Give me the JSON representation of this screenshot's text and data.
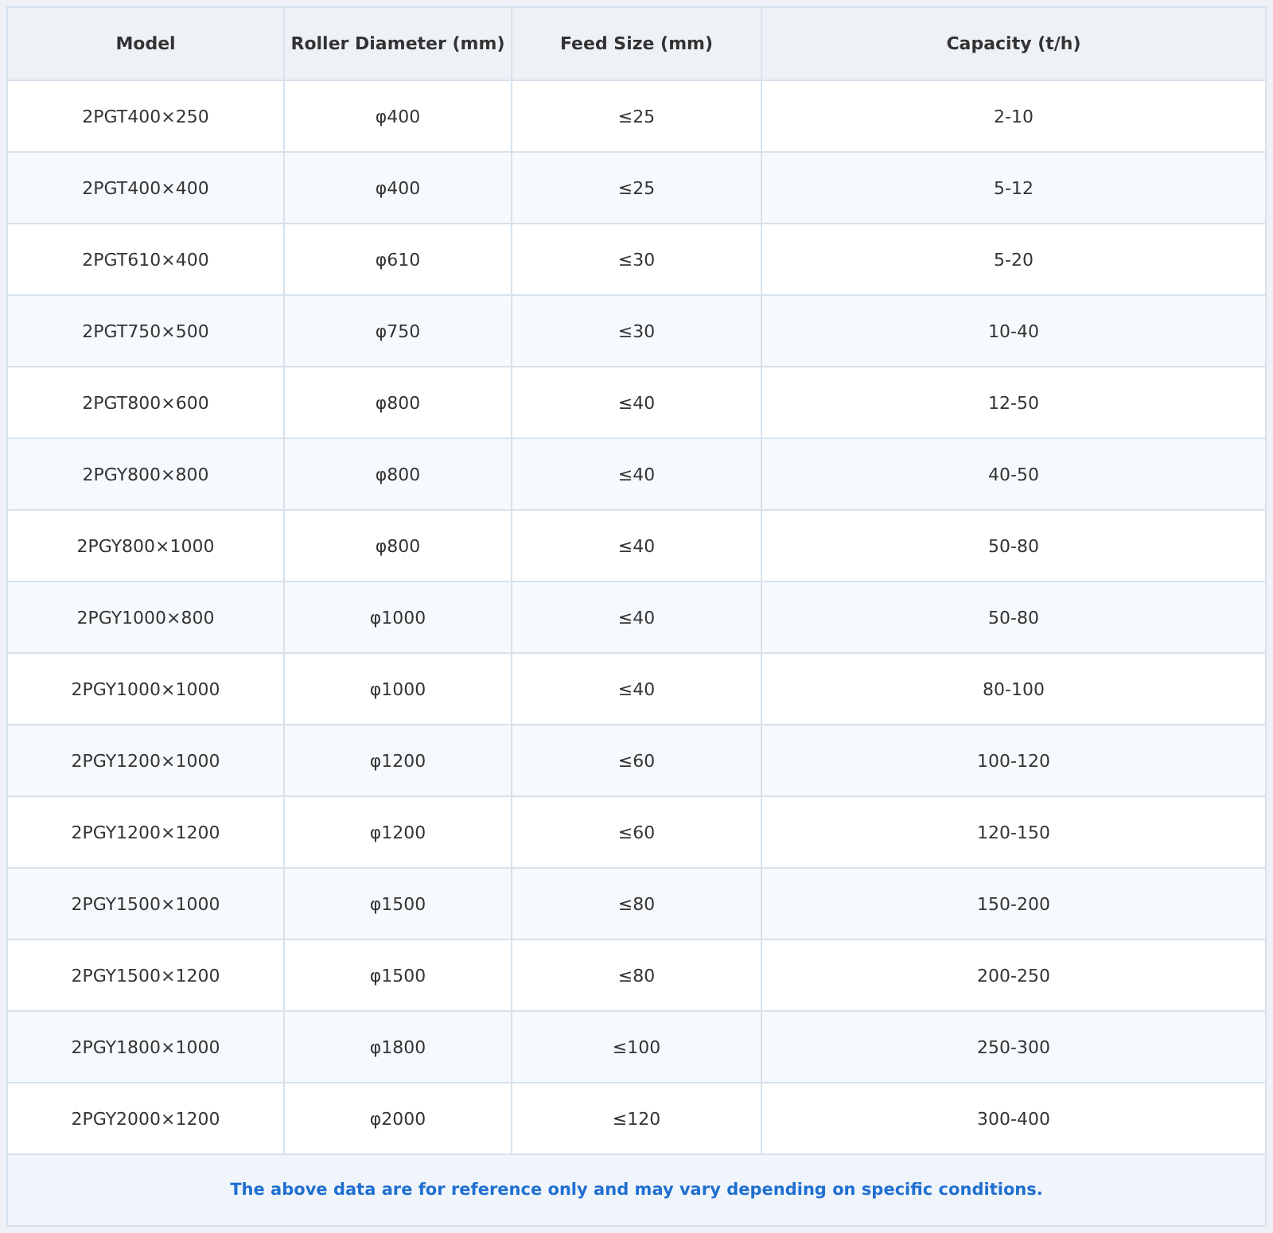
{
  "table": {
    "columns": [
      "Model",
      "Roller Diameter (mm)",
      "Feed Size (mm)",
      "Capacity (t/h)"
    ],
    "rows": [
      [
        "2PGT400×250",
        "φ400",
        "≤25",
        "2-10"
      ],
      [
        "2PGT400×400",
        "φ400",
        "≤25",
        "5-12"
      ],
      [
        "2PGT610×400",
        "φ610",
        "≤30",
        "5-20"
      ],
      [
        "2PGT750×500",
        "φ750",
        "≤30",
        "10-40"
      ],
      [
        "2PGT800×600",
        "φ800",
        "≤40",
        "12-50"
      ],
      [
        "2PGY800×800",
        "φ800",
        "≤40",
        "40-50"
      ],
      [
        "2PGY800×1000",
        "φ800",
        "≤40",
        "50-80"
      ],
      [
        "2PGY1000×800",
        "φ1000",
        "≤40",
        "50-80"
      ],
      [
        "2PGY1000×1000",
        "φ1000",
        "≤40",
        "80-100"
      ],
      [
        "2PGY1200×1000",
        "φ1200",
        "≤60",
        "100-120"
      ],
      [
        "2PGY1200×1200",
        "φ1200",
        "≤60",
        "120-150"
      ],
      [
        "2PGY1500×1000",
        "φ1500",
        "≤80",
        "150-200"
      ],
      [
        "2PGY1500×1200",
        "φ1500",
        "≤80",
        "200-250"
      ],
      [
        "2PGY1800×1000",
        "φ1800",
        "≤100",
        "250-300"
      ],
      [
        "2PGY2000×1200",
        "φ2000",
        "≤120",
        "300-400"
      ]
    ],
    "footnote": "The above data are for reference only and may vary depending on specific conditions."
  }
}
